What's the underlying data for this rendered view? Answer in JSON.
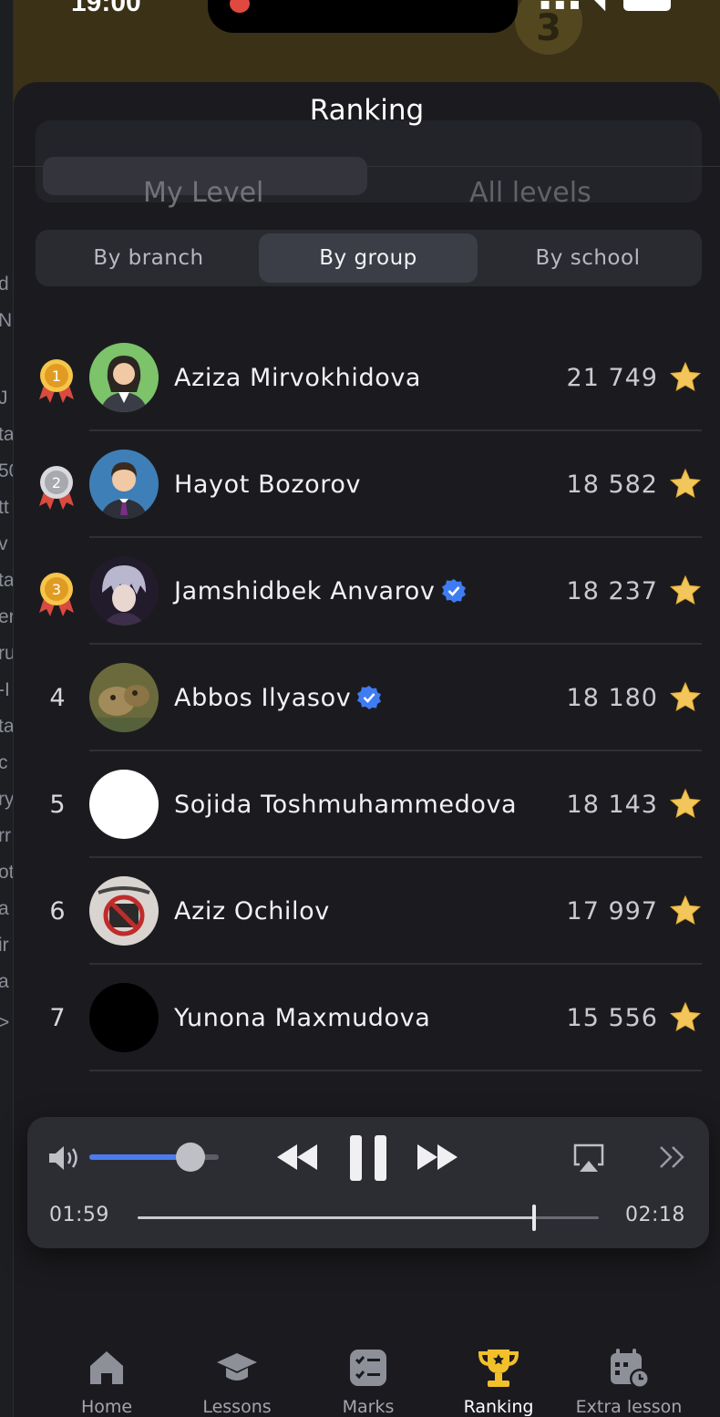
{
  "status_bar": {
    "time": "19:00",
    "background_badge": "3"
  },
  "left_strip_letters": [
    "d",
    "N",
    "J",
    "ta",
    "50",
    "tt",
    "v",
    "ta",
    "er",
    "ru",
    "-I",
    "ta",
    "c",
    "ry",
    "rr",
    "ot",
    "a",
    "ir",
    "a",
    ">"
  ],
  "sheet": {
    "title": "Ranking"
  },
  "level_segment": {
    "options": [
      "My Level",
      "All levels"
    ],
    "selected": "My Level"
  },
  "scope_segment": {
    "options": [
      "By branch",
      "By group",
      "By school"
    ],
    "selected": "By group"
  },
  "ranking": [
    {
      "rank": "1",
      "name": "Aziza Mirvokhidova",
      "score": "21 749",
      "verified": false,
      "medal": "gold",
      "avatar": "female-user"
    },
    {
      "rank": "2",
      "name": "Hayot Bozorov",
      "score": "18 582",
      "verified": false,
      "medal": "silver",
      "avatar": "male-user"
    },
    {
      "rank": "3",
      "name": "Jamshidbek Anvarov",
      "score": "18 237",
      "verified": true,
      "medal": "bronze",
      "avatar": "anime-photo"
    },
    {
      "rank": "4",
      "name": "Abbos Ilyasov",
      "score": "18 180",
      "verified": true,
      "medal": null,
      "avatar": "animal-photo"
    },
    {
      "rank": "5",
      "name": "Sojida Toshmuhammedova",
      "score": "18 143",
      "verified": false,
      "medal": null,
      "avatar": "white-circle"
    },
    {
      "rank": "6",
      "name": "Aziz Ochilov",
      "score": "17 997",
      "verified": false,
      "medal": null,
      "avatar": "sticker-photo"
    },
    {
      "rank": "7",
      "name": "Yunona Maxmudova",
      "score": "15 556",
      "verified": false,
      "medal": null,
      "avatar": "black-circle"
    }
  ],
  "player": {
    "elapsed": "01:59",
    "total": "02:18",
    "progress_fraction": 0.86,
    "volume_fraction": 0.78
  },
  "tabbar": {
    "items": [
      {
        "label": "Home",
        "icon": "home-icon",
        "active": false
      },
      {
        "label": "Lessons",
        "icon": "graduation-cap-icon",
        "active": false
      },
      {
        "label": "Marks",
        "icon": "checklist-icon",
        "active": false
      },
      {
        "label": "Ranking",
        "icon": "trophy-icon",
        "active": true
      },
      {
        "label": "Extra lesson",
        "icon": "calendar-clock-icon",
        "active": false
      }
    ]
  },
  "colors": {
    "accent_blue": "#4c7bf0",
    "gold": "#f2c02b",
    "sheet_bg": "#1b1b1f",
    "verified_blue": "#3f7cf2"
  }
}
